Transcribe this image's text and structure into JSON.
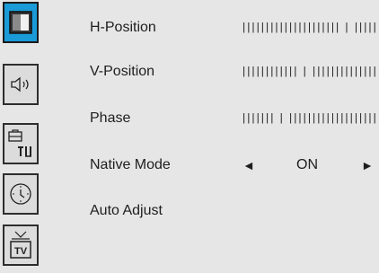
{
  "sidebar": {
    "tabs": [
      {
        "icon": "display-icon",
        "active": true
      },
      {
        "icon": "speaker-icon",
        "active": false
      },
      {
        "icon": "tools-icon",
        "active": false
      },
      {
        "icon": "clock-icon",
        "active": false
      },
      {
        "icon": "tv-icon",
        "tv_label": "TV",
        "active": false
      }
    ]
  },
  "menu": {
    "h_position": {
      "label": "H-Position",
      "value": "||||||||||||||||||||| | ||||||||"
    },
    "v_position": {
      "label": "V-Position",
      "value": "|||||||||||| | ||||||||||||||||||"
    },
    "phase": {
      "label": "Phase",
      "value": "||||||| | |||||||||||||||||||||||"
    },
    "native_mode": {
      "label": "Native Mode",
      "value": "ON",
      "left_arrow": "◄",
      "right_arrow": "►"
    },
    "auto_adjust": {
      "label": "Auto Adjust"
    }
  },
  "colors": {
    "accent": "#1a9bd8",
    "background": "#e6e6e6",
    "text": "#1e1e1e"
  }
}
